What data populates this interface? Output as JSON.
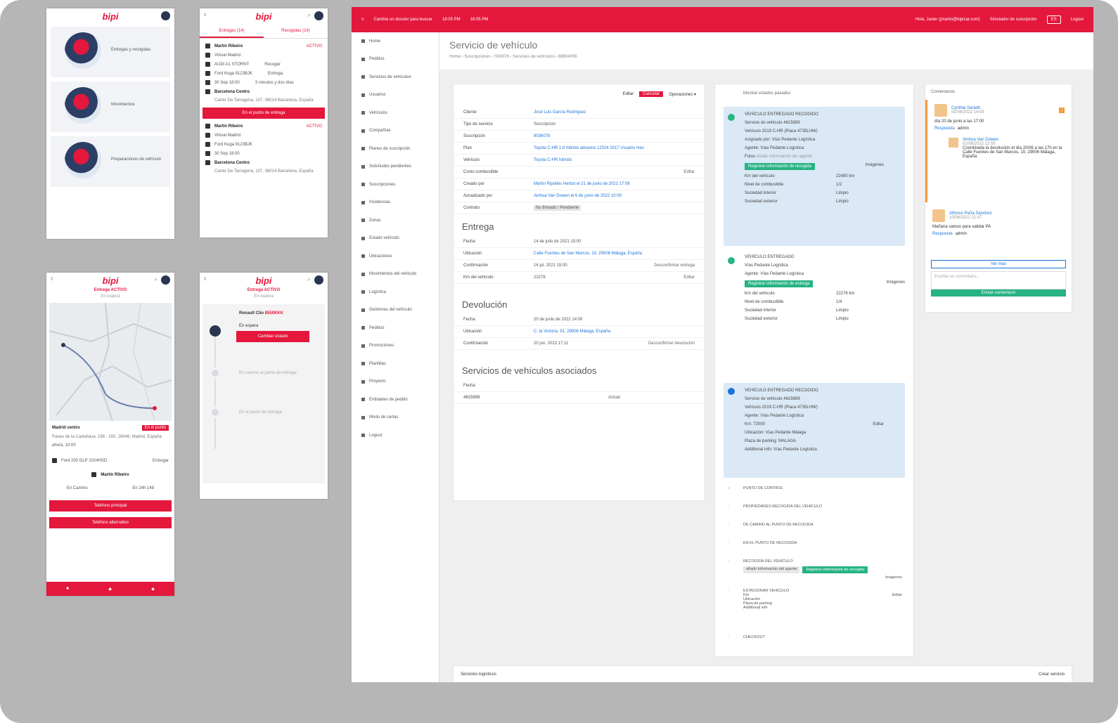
{
  "brand": "bipi",
  "m1": {
    "cards": [
      "Entregas y recogidas",
      "Movimientos",
      "Preparaciones de vehículo"
    ]
  },
  "m2": {
    "tabs": [
      "Entregas (14)",
      "Recogidas (14)"
    ],
    "tasks": [
      {
        "name": "Martín Ribeiro",
        "status": "ACTIVO",
        "company": "Virtual Madrid",
        "car": "AUDI A1 STORNT",
        "type1": "Recoger",
        "plate": "Ford Kuga 9123BJK",
        "type2": "Entrega",
        "date": "30 Sep 18:00",
        "time": "3 minutos y dos días",
        "place": "Barcelona Centro",
        "address": "Carrer De Tarragona, 107, 08014 Barcelona, España",
        "button": "En el punto de entrega"
      },
      {
        "name": "Martín Ribeiro",
        "status": "ACTIVO",
        "company": "Virtual Madrid",
        "plate": "Ford Kuga 9123BJK",
        "date": "30 Sep 18:00",
        "place": "Barcelona Centro",
        "address": "Carrer De Tarragona, 107, 08014 Barcelona, España"
      }
    ]
  },
  "m3": {
    "title": "Entrega ACTIVO",
    "status": "En espera",
    "place": "Madrid centro",
    "badge": "En el punto",
    "address": "Paseo de la Castellana, 196 - 200, 28046, Madrid, España",
    "time": "ahora, 10:00",
    "car": "Ford 200 GLP 2024HSD",
    "type": "Entregar",
    "driver": "Martín Ribeiro",
    "chip1": "En Camino",
    "chip2": "En 24h 148",
    "btn1": "Teléfono principal",
    "btn2": "Teléfono alternativo"
  },
  "m4": {
    "title": "Entrega ACTIVO",
    "status": "En espera",
    "car": "Renault Clio",
    "plate": "8550KKK",
    "steps": [
      "En espera",
      "En camino al punto de entrega",
      "En el punto de entrega"
    ],
    "button": "Cambiar estado"
  },
  "web": {
    "topbar": {
      "alert": "Cambia un dossier para buscar",
      "t1": "18:05 PM",
      "t2": "18:05 PM",
      "user": "Hola, Javier (jmartin@bipicar.com)",
      "sim": "Simulador de suscripción",
      "lang": "ES",
      "logout": "Logout"
    },
    "sidebar": [
      "Home",
      "Pedidos",
      "Servicios de vehículos",
      "Usuarios",
      "Vehículos",
      "Compañías",
      "Planes de suscripción",
      "Solicitudes pendientes",
      "Suscripciones",
      "Incidencias",
      "Zonas",
      "Estado vehículo",
      "Ubicaciones",
      "Movimientos del vehículo",
      "Logística",
      "Gestiones del vehículo",
      "Pedidos",
      "Promociones",
      "Plantillas",
      "Proyecto",
      "Entidades de pedido",
      "Modo de cartas",
      "Logout"
    ],
    "page": {
      "title": "Servicio de vehículo",
      "breadcrumb": "Home  ›  Suscripciones  ›  S04378  ›  Servicios de vehículos  ›  88804006"
    },
    "detail": {
      "actions": {
        "edit": "Editar",
        "cancel": "Cancelar",
        "ops": "Operaciones ▾"
      },
      "rows": [
        {
          "k": "Cliente",
          "v": "José Luis García Rodríguez"
        },
        {
          "k": "Tipo de servicio",
          "v": "Suscripción"
        },
        {
          "k": "Suscripción",
          "v": "8036078"
        },
        {
          "k": "Plan",
          "v": "Toyota C-HR 1.8 hibrido advance 12024 2017 Usuario mes"
        },
        {
          "k": "Vehículo",
          "v": "Toyota C-HR híbrido"
        },
        {
          "k": "Costo combustible",
          "v": "",
          "a": "Editar"
        },
        {
          "k": "Creado por",
          "v": "Martín Ripollés Herbst el 21 de junio de 2021 17:06"
        },
        {
          "k": "Actualizado por",
          "v": "Ainhoa Van Dowen el 6 de junio de 2022 10:00"
        },
        {
          "k": "Contrato",
          "v": "No firmado / Pendiente"
        }
      ],
      "entrega_title": "Entrega",
      "entrega": [
        {
          "k": "Fecha",
          "v": "14 de julio de 2021 15:00"
        },
        {
          "k": "Ubicación",
          "v": "Calle Fuentes de San Marcos, 10, 29006 Málaga, España"
        },
        {
          "k": "Confirmación",
          "v": "14 jul. 2021 15:00",
          "a": "Desconfirmar entrega"
        },
        {
          "k": "Km del vehículo",
          "v": "22276",
          "a": "Editar"
        }
      ],
      "devolucion_title": "Devolución",
      "devolucion": [
        {
          "k": "Fecha",
          "v": "20 de junio de 2022 14:00"
        },
        {
          "k": "Ubicación",
          "v": "C. la Victoria, 91, 29006 Málaga, España"
        },
        {
          "k": "Confirmación",
          "v": "20 jun. 2022 17:11",
          "a": "Desconfirmar devolución"
        }
      ],
      "assoc_title": "Servicios de vehículos asociados",
      "assoc_head": "Fecha",
      "assoc_row": [
        "4815699",
        "Actual"
      ]
    },
    "timeline": {
      "header": "Mostrar estados pasados",
      "b1": {
        "title": "VEHÍCULO ENTREGADO RECOGIDO",
        "service": "Servicio de vehículo 4815699",
        "vehicle": "Vehículo 2019 C-HR (Placa 4735LHW)",
        "asig": "Asignado por: Vías Pedante Logística",
        "agent": "Agente: Vías Pedante Logística",
        "photo": "Fotos",
        "photo_v": "añadir información del agente",
        "btn": "Registrar información de recogida",
        "img": "Imágenes",
        "km": "Km del vehículo",
        "km_v": "22480 km",
        "fuel": "Nivel de combustible",
        "fuel_v": "1/2",
        "int": "Suciedad interior",
        "int_v": "Limpio",
        "ext": "Suciedad exterior",
        "ext_v": "Limpio"
      },
      "b2": {
        "title": "VEHÍCULO ENTREGADO",
        "asig": "Vías Pedante Logística",
        "agent": "Agente: Vías Pedante Logística",
        "btn": "Registrar información de entrega",
        "img": "Imágenes",
        "km_v": "22276 km",
        "fuel_v": "1/4",
        "int_v": "Limpio",
        "ext_v": "Limpio"
      },
      "b3": {
        "title": "VEHÍCULO ENTREGADO RECOGIDO",
        "service": "Servicio de vehículo 4815699",
        "vehicle": "Vehículo 2019 C-HR (Placa 4735LHW)",
        "agent": "Agente: Vías Pedante Logística",
        "km": "Km: 72000",
        "loc": "Ubicación: Vías Pedante Málaga",
        "park": "Plaza de parking: MALAGA",
        "info": "Additional info: Vías Pedante Logística",
        "edit": "Editar"
      },
      "steps": [
        "PUNTO DE CONTROL",
        "PROPIEDADES RECOGIDA DEL VEHÍCULO",
        "DE CAMINO AL PUNTO DE RECOGIDA",
        "EN EL PUNTO DE RECOGIDA",
        "RECOGIDA DEL VEHÍCULO",
        "ESTACIONAR VEHÍCULO",
        "CHECKOUT"
      ],
      "chip_a": "añadir información del agente",
      "chip_b": "Registrar información de recogida",
      "img": "Imágenes",
      "park": [
        "Km",
        "Ubicación",
        "Plaza de parking",
        "Additional info"
      ],
      "edit": "Editar"
    },
    "comments": {
      "title": "Comentarios",
      "c1": {
        "name": "Cynthia Saradit",
        "date": "02/06/2022 14:55",
        "text": "día 20 de junio a las 17:00",
        "tag1": "Respuesta",
        "tag2": "admin",
        "reply": "Ainhoa Van Dowen",
        "reply_date": "02/06/2022 13:55",
        "reply_text": "Coordinada la devolución el día 20/06 a las 17h en la Calle Fuentes de San Marcos, 10, 29006 Málaga, España"
      },
      "c2": {
        "name": "Alfonso Peña Sánchez",
        "date": "10/06/2022 11:47",
        "text": "Mañana vamos para validar PA",
        "tag1": "Respuesta",
        "tag2": "admin"
      },
      "view_more": "Ver más",
      "placeholder": "Escribe un comentario...",
      "send": "Enviar comentario"
    },
    "footer": {
      "left": "Servicios logísticos",
      "right": "Crear servicio"
    }
  }
}
